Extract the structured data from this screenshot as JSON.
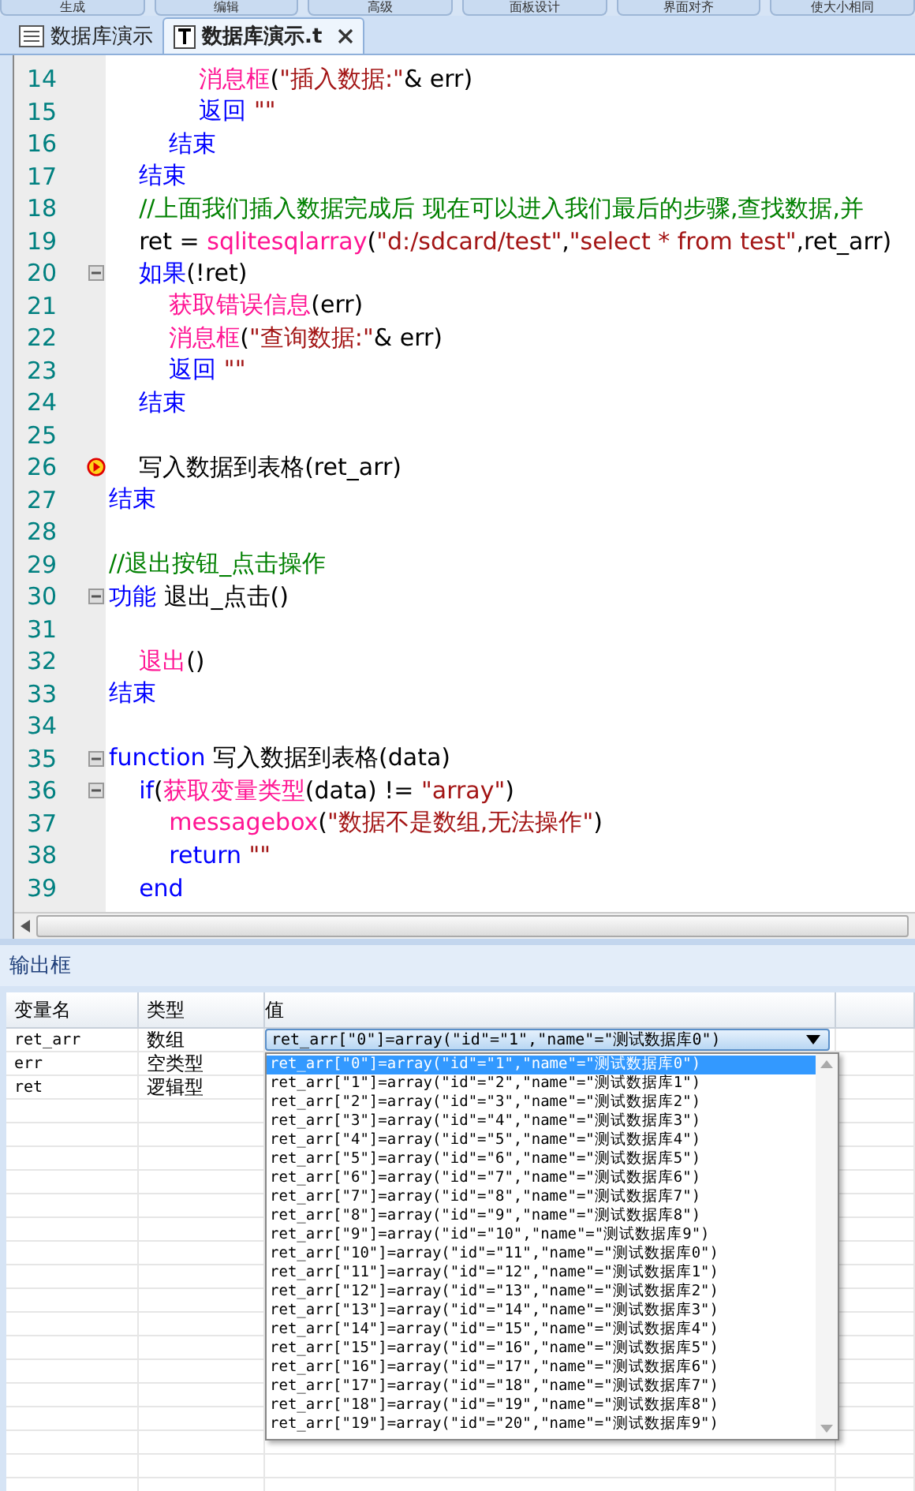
{
  "toolbar": [
    {
      "label": "生成"
    },
    {
      "label": "编辑"
    },
    {
      "label": "高级"
    },
    {
      "label": "面板设计"
    },
    {
      "label": "界面对齐"
    },
    {
      "label": "使大小相同"
    }
  ],
  "tabs": [
    {
      "label": "数据库演示",
      "kind": "form",
      "selected": false,
      "closable": false
    },
    {
      "label": "数据库演示.t",
      "kind": "text",
      "selected": true,
      "closable": true
    }
  ],
  "editor": {
    "lines": [
      {
        "number": "14",
        "fold": false,
        "breakpoint": false,
        "segments": [
          {
            "kind": "func",
            "text": "            消息框"
          },
          {
            "kind": "plain",
            "text": "("
          },
          {
            "kind": "string",
            "text": "\"插入数据:\""
          },
          {
            "kind": "plain",
            "text": "& err)"
          }
        ]
      },
      {
        "number": "15",
        "fold": false,
        "breakpoint": false,
        "segments": [
          {
            "kind": "keyword",
            "text": "            返回 "
          },
          {
            "kind": "string",
            "text": "\"\""
          }
        ]
      },
      {
        "number": "16",
        "fold": false,
        "breakpoint": false,
        "segments": [
          {
            "kind": "keyword",
            "text": "        结束"
          }
        ]
      },
      {
        "number": "17",
        "fold": false,
        "breakpoint": false,
        "segments": [
          {
            "kind": "keyword",
            "text": "    结束"
          }
        ]
      },
      {
        "number": "18",
        "fold": false,
        "breakpoint": false,
        "segments": [
          {
            "kind": "comment",
            "text": "    //上面我们插入数据完成后 现在可以进入我们最后的步骤,查找数据,并"
          }
        ]
      },
      {
        "number": "19",
        "fold": false,
        "breakpoint": false,
        "segments": [
          {
            "kind": "plain",
            "text": "    ret = "
          },
          {
            "kind": "func",
            "text": "sqlitesqlarray"
          },
          {
            "kind": "plain",
            "text": "("
          },
          {
            "kind": "string",
            "text": "\"d:/sdcard/test\""
          },
          {
            "kind": "plain",
            "text": ","
          },
          {
            "kind": "string",
            "text": "\"select * from test\""
          },
          {
            "kind": "plain",
            "text": ",ret_arr)"
          }
        ]
      },
      {
        "number": "20",
        "fold": true,
        "breakpoint": false,
        "segments": [
          {
            "kind": "keyword",
            "text": "    如果"
          },
          {
            "kind": "plain",
            "text": "(!ret)"
          }
        ]
      },
      {
        "number": "21",
        "fold": false,
        "breakpoint": false,
        "segments": [
          {
            "kind": "func",
            "text": "        获取错误信息"
          },
          {
            "kind": "plain",
            "text": "(err)"
          }
        ]
      },
      {
        "number": "22",
        "fold": false,
        "breakpoint": false,
        "segments": [
          {
            "kind": "func",
            "text": "        消息框"
          },
          {
            "kind": "plain",
            "text": "("
          },
          {
            "kind": "string",
            "text": "\"查询数据:\""
          },
          {
            "kind": "plain",
            "text": "& err)"
          }
        ]
      },
      {
        "number": "23",
        "fold": false,
        "breakpoint": false,
        "segments": [
          {
            "kind": "keyword",
            "text": "        返回 "
          },
          {
            "kind": "string",
            "text": "\"\""
          }
        ]
      },
      {
        "number": "24",
        "fold": false,
        "breakpoint": false,
        "segments": [
          {
            "kind": "keyword",
            "text": "    结束"
          }
        ]
      },
      {
        "number": "25",
        "fold": false,
        "breakpoint": false
      },
      {
        "number": "26",
        "fold": false,
        "breakpoint": true,
        "segments": [
          {
            "kind": "plain",
            "text": "    写入数据到表格(ret_arr)"
          }
        ]
      },
      {
        "number": "27",
        "fold": false,
        "breakpoint": false,
        "segments": [
          {
            "kind": "keyword",
            "text": "结束"
          }
        ]
      },
      {
        "number": "28",
        "fold": false,
        "breakpoint": false
      },
      {
        "number": "29",
        "fold": false,
        "breakpoint": false,
        "segments": [
          {
            "kind": "comment",
            "text": "//退出按钮_点击操作"
          }
        ]
      },
      {
        "number": "30",
        "fold": true,
        "breakpoint": false,
        "segments": [
          {
            "kind": "keyword",
            "text": "功能 "
          },
          {
            "kind": "plain",
            "text": "退出_点击()"
          }
        ]
      },
      {
        "number": "31",
        "fold": false,
        "breakpoint": false
      },
      {
        "number": "32",
        "fold": false,
        "breakpoint": false,
        "segments": [
          {
            "kind": "func",
            "text": "    退出"
          },
          {
            "kind": "plain",
            "text": "()"
          }
        ]
      },
      {
        "number": "33",
        "fold": false,
        "breakpoint": false,
        "segments": [
          {
            "kind": "keyword",
            "text": "结束"
          }
        ]
      },
      {
        "number": "34",
        "fold": false,
        "breakpoint": false
      },
      {
        "number": "35",
        "fold": true,
        "breakpoint": false,
        "segments": [
          {
            "kind": "keyword",
            "text": "function "
          },
          {
            "kind": "plain",
            "text": "写入数据到表格(data)"
          }
        ]
      },
      {
        "number": "36",
        "fold": true,
        "breakpoint": false,
        "segments": [
          {
            "kind": "keyword",
            "text": "    if"
          },
          {
            "kind": "plain",
            "text": "("
          },
          {
            "kind": "func",
            "text": "获取变量类型"
          },
          {
            "kind": "plain",
            "text": "(data) != "
          },
          {
            "kind": "string",
            "text": "\"array\""
          },
          {
            "kind": "plain",
            "text": ")"
          }
        ]
      },
      {
        "number": "37",
        "fold": false,
        "breakpoint": false,
        "segments": [
          {
            "kind": "func",
            "text": "        messagebox"
          },
          {
            "kind": "plain",
            "text": "("
          },
          {
            "kind": "string",
            "text": "\"数据不是数组,无法操作\""
          },
          {
            "kind": "plain",
            "text": ")"
          }
        ]
      },
      {
        "number": "38",
        "fold": false,
        "breakpoint": false,
        "segments": [
          {
            "kind": "keyword",
            "text": "        return "
          },
          {
            "kind": "string",
            "text": "\"\""
          }
        ]
      },
      {
        "number": "39",
        "fold": false,
        "breakpoint": false,
        "segments": [
          {
            "kind": "keyword",
            "text": "    end"
          }
        ]
      }
    ]
  },
  "output": {
    "title": "输出框",
    "columns": [
      "变量名",
      "类型",
      "值"
    ],
    "rows": [
      {
        "name": "ret_arr",
        "type": "数组",
        "value": "ret_arr[\"0\"]=array(\"id\"=\"1\",\"name\"=\"测试数据库0\")",
        "dropdown": true
      },
      {
        "name": "err",
        "type": "空类型",
        "value": "",
        "dropdown": false
      },
      {
        "name": "ret",
        "type": "逻辑型",
        "value": "",
        "dropdown": false
      }
    ],
    "dropdown_options": [
      {
        "text": "ret_arr[\"0\"]=array(\"id\"=\"1\",\"name\"=\"测试数据库0\")",
        "selected": true
      },
      {
        "text": "ret_arr[\"1\"]=array(\"id\"=\"2\",\"name\"=\"测试数据库1\")",
        "selected": false
      },
      {
        "text": "ret_arr[\"2\"]=array(\"id\"=\"3\",\"name\"=\"测试数据库2\")",
        "selected": false
      },
      {
        "text": "ret_arr[\"3\"]=array(\"id\"=\"4\",\"name\"=\"测试数据库3\")",
        "selected": false
      },
      {
        "text": "ret_arr[\"4\"]=array(\"id\"=\"5\",\"name\"=\"测试数据库4\")",
        "selected": false
      },
      {
        "text": "ret_arr[\"5\"]=array(\"id\"=\"6\",\"name\"=\"测试数据库5\")",
        "selected": false
      },
      {
        "text": "ret_arr[\"6\"]=array(\"id\"=\"7\",\"name\"=\"测试数据库6\")",
        "selected": false
      },
      {
        "text": "ret_arr[\"7\"]=array(\"id\"=\"8\",\"name\"=\"测试数据库7\")",
        "selected": false
      },
      {
        "text": "ret_arr[\"8\"]=array(\"id\"=\"9\",\"name\"=\"测试数据库8\")",
        "selected": false
      },
      {
        "text": "ret_arr[\"9\"]=array(\"id\"=\"10\",\"name\"=\"测试数据库9\")",
        "selected": false
      },
      {
        "text": "ret_arr[\"10\"]=array(\"id\"=\"11\",\"name\"=\"测试数据库0\")",
        "selected": false
      },
      {
        "text": "ret_arr[\"11\"]=array(\"id\"=\"12\",\"name\"=\"测试数据库1\")",
        "selected": false
      },
      {
        "text": "ret_arr[\"12\"]=array(\"id\"=\"13\",\"name\"=\"测试数据库2\")",
        "selected": false
      },
      {
        "text": "ret_arr[\"13\"]=array(\"id\"=\"14\",\"name\"=\"测试数据库3\")",
        "selected": false
      },
      {
        "text": "ret_arr[\"14\"]=array(\"id\"=\"15\",\"name\"=\"测试数据库4\")",
        "selected": false
      },
      {
        "text": "ret_arr[\"15\"]=array(\"id\"=\"16\",\"name\"=\"测试数据库5\")",
        "selected": false
      },
      {
        "text": "ret_arr[\"16\"]=array(\"id\"=\"17\",\"name\"=\"测试数据库6\")",
        "selected": false
      },
      {
        "text": "ret_arr[\"17\"]=array(\"id\"=\"18\",\"name\"=\"测试数据库7\")",
        "selected": false
      },
      {
        "text": "ret_arr[\"18\"]=array(\"id\"=\"19\",\"name\"=\"测试数据库8\")",
        "selected": false
      },
      {
        "text": "ret_arr[\"19\"]=array(\"id\"=\"20\",\"name\"=\"测试数据库9\")",
        "selected": false
      }
    ]
  }
}
